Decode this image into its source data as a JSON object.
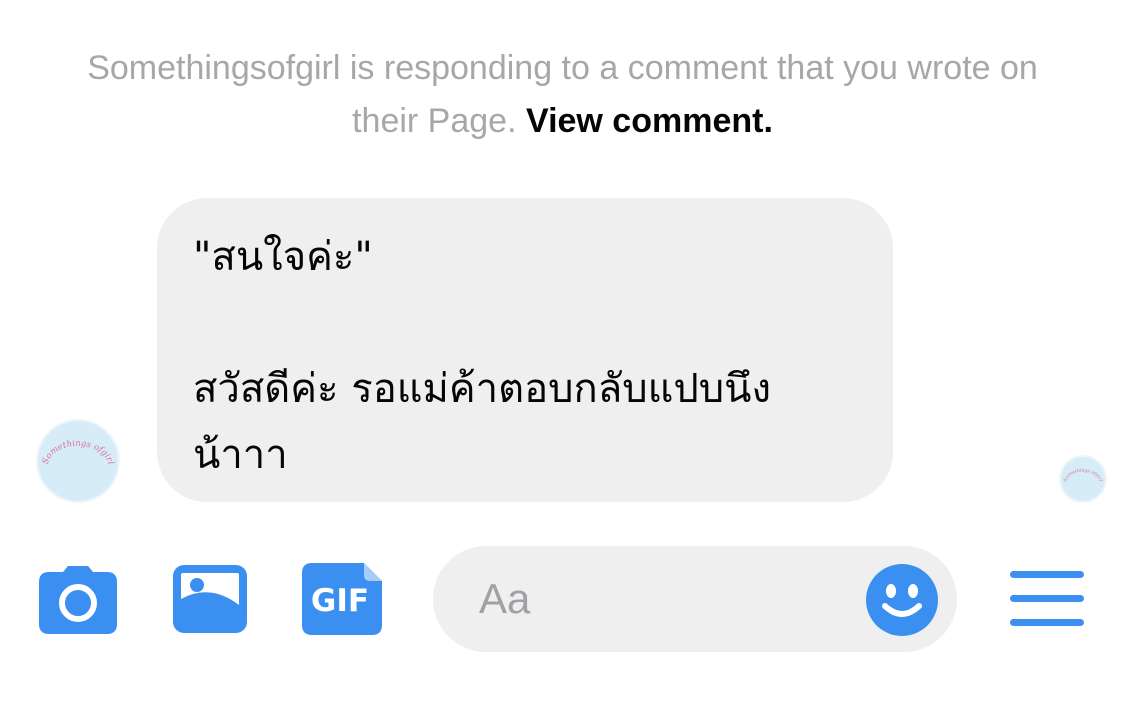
{
  "notice": {
    "text": "Somethingsofgirl is responding to a comment that you wrote on their Page.",
    "link": "View comment."
  },
  "message": {
    "quote": "\"สนใจค่ะ\"",
    "body_line1": "สวัสดีค่ะ รอแม่ค้าตอบกลับแปบนึง",
    "body_line2": "น้าาา"
  },
  "avatar": {
    "text": "Somethings ofgirl",
    "color": "#d6ecf7"
  },
  "composer": {
    "placeholder": "Aa"
  },
  "toolbar": {
    "gif_label": "GIF",
    "icons": [
      "camera-icon",
      "photo-icon",
      "gif-icon",
      "emoji-icon",
      "menu-icon"
    ],
    "accent": "#3b8ff0"
  }
}
